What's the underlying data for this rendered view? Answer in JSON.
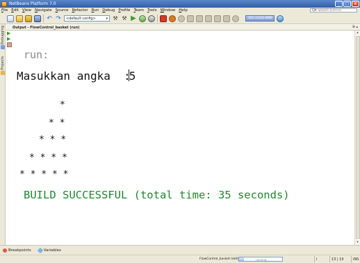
{
  "window": {
    "title": "NetBeans Platform 7.0",
    "controls": {
      "minimize": "_",
      "maximize": "□",
      "close": "×"
    }
  },
  "menu": {
    "items": [
      "File",
      "Edit",
      "View",
      "Navigate",
      "Source",
      "Refactor",
      "Run",
      "Debug",
      "Profile",
      "Team",
      "Tools",
      "Window",
      "Help"
    ],
    "search_placeholder": "Search (Ctrl+I)"
  },
  "toolbar": {
    "config_value": "<default config>",
    "config_arrow": "▾",
    "memory_label": "102.1/183.4MB"
  },
  "left_strip": {
    "tabs": [
      "Debugging",
      "Projects"
    ]
  },
  "output": {
    "title": "Output - FlowControl_basket (run)",
    "panel_controls": "⊗ ▴",
    "lines": {
      "run": "run:",
      "prompt": "Masukkan angka  :",
      "input_value": "5",
      "star_rows": [
        "*",
        "* *",
        "* * *",
        "* * * *",
        "* * * * *"
      ],
      "build": "BUILD SUCCESSFUL (total time: 35 seconds)"
    }
  },
  "bottom_tabs": {
    "breakpoints": "Breakpoints",
    "variables": "Variables"
  },
  "status": {
    "project_label": "FlowControl_basket (default)",
    "progress_label": "running...",
    "progress_fraction": 0.12,
    "cell_icon": "i",
    "position": "13 | 13",
    "mode": "INS"
  },
  "colors": {
    "build_success": "#1a8a2a",
    "run_label": "#8a8a8a",
    "titlebar": "#2f5fae"
  }
}
